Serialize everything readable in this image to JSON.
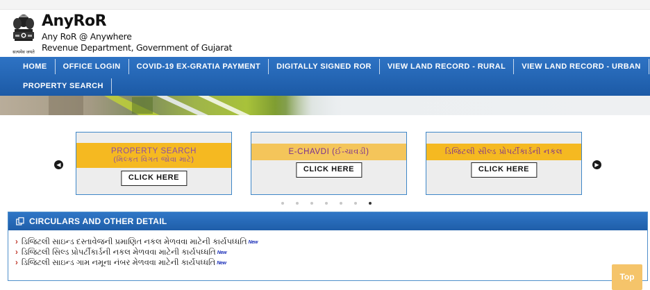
{
  "header": {
    "title": "AnyRoR",
    "tagline": "Any RoR @ Anywhere",
    "department": "Revenue Department, Government of Gujarat",
    "emblem_caption": "सत्यमेव जयते"
  },
  "nav": {
    "row1": [
      "HOME",
      "OFFICE LOGIN",
      "COVID-19 EX-GRATIA PAYMENT",
      "DIGITALLY SIGNED ROR",
      "VIEW LAND RECORD - RURAL",
      "VIEW LAND RECORD - URBAN"
    ],
    "row2": [
      "PROPERTY SEARCH"
    ]
  },
  "carousel": {
    "cards": [
      {
        "title": "PROPERTY SEARCH",
        "subtitle": "(મિલ્કત વિગત જોવા માટે)",
        "button": "CLICK HERE"
      },
      {
        "title": "E-CHAVDI (ઈ-ચાવડી)",
        "subtitle": "",
        "button": "CLICK HERE"
      },
      {
        "title": "ડિજિટલી સીલ્ડ પ્રોપર્ટીકાર્ડની નકલ",
        "subtitle": "",
        "button": "CLICK HERE"
      }
    ],
    "prev_icon": "chevron-left-icon",
    "next_icon": "chevron-right-icon",
    "dot_count": 7,
    "active_dot": 6
  },
  "circulars": {
    "heading": "CIRCULARS AND OTHER DETAIL",
    "heading_icon": "copy-icon",
    "new_label": "New",
    "items": [
      "ડિજિટલી સાઇન્ડ દસ્તાવેજની પ્રમાણિત નકલ મેળવવા માટેની કાર્યપધ્ધતિ",
      "ડિજિટલી સિલ્ડ પ્રોપર્ટીકાર્ડની નકલ મેળવવા માટેની કાર્યપધ્ધતિ",
      "ડિજિટલી સાઇન્ડ ગામ નમૂના નંબર મેળવવા માટેની કાર્યપધ્ધતિ"
    ]
  },
  "top_button": "Top",
  "colors": {
    "nav_blue": "#1f5ea9",
    "card_yellow": "#f5b921",
    "card_text_purple": "#8a4fa5",
    "card_border": "#3e86c8",
    "top_button": "#f5c46a"
  }
}
